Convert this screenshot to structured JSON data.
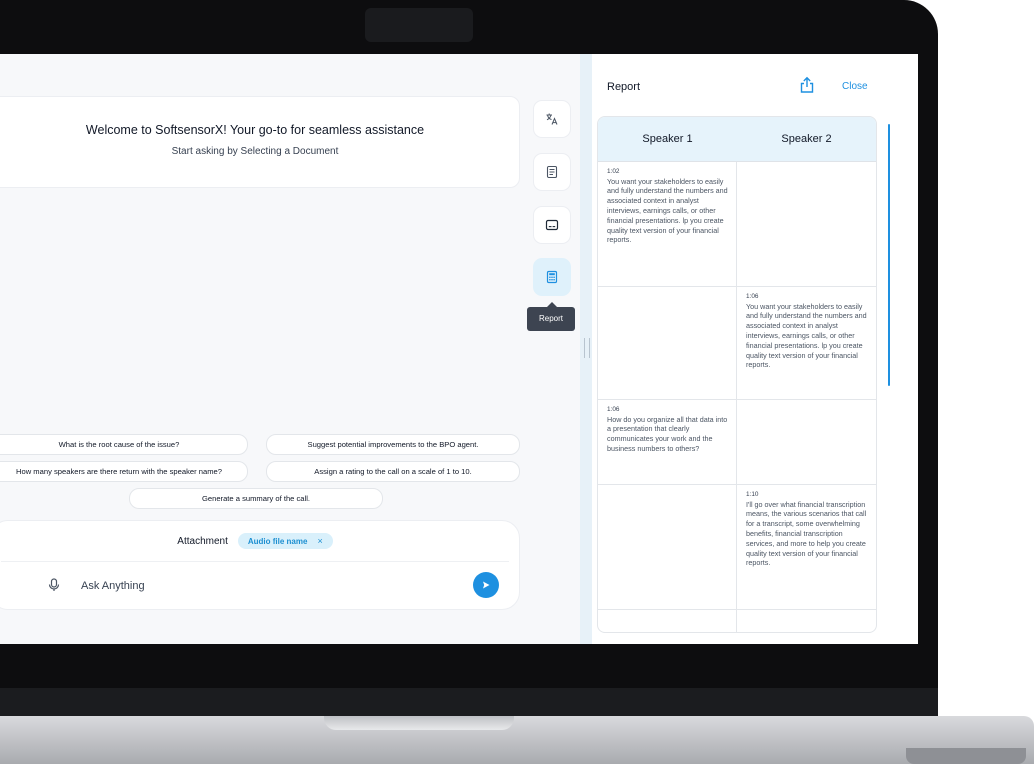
{
  "chat": {
    "welcome_title": "Welcome to SoftsensorX! Your go-to for seamless assistance",
    "welcome_subtitle": "Start asking by Selecting a Document",
    "suggestions": [
      "What is  the root cause of the issue?",
      "Suggest potential improvements to the BPO agent.",
      "How many speakers are there return with the speaker name?",
      "Assign a rating to the call on a scale of 1 to 10.",
      "Generate a summary of the call."
    ],
    "attachment_label": "Attachment",
    "attachment_file": "Audio file name",
    "attachment_remove": "×",
    "input_placeholder": "Ask Anything"
  },
  "rail": {
    "buttons": [
      "translate-icon",
      "document-icon",
      "subtitles-icon",
      "calculator-icon"
    ],
    "active": "calculator-icon",
    "tooltip": "Report"
  },
  "report": {
    "title": "Report",
    "close_label": "Close",
    "columns": [
      "Speaker 1",
      "Speaker 2"
    ],
    "rows": [
      {
        "speaker": 1,
        "time": "1:02",
        "text": "You want your stakeholders to easily and fully understand the numbers and associated context in analyst interviews, earnings calls, or other financial presentations. lp you create quality text version of your financial reports."
      },
      {
        "speaker": 2,
        "time": "1:06",
        "text": "You want your stakeholders to easily and fully understand the numbers and associated context in analyst interviews, earnings calls, or other financial presentations. lp you create quality text version of your financial reports."
      },
      {
        "speaker": 1,
        "time": "1:06",
        "text": "How do you organize all that data into a presentation that clearly communicates your work and the business numbers to others?"
      },
      {
        "speaker": 2,
        "time": "1:10",
        "text": "I'll go over what financial transcription means, the various scenarios that call for a transcript, some overwhelming benefits, financial transcription services, and more to help you create quality text version of your financial reports."
      }
    ]
  },
  "colors": {
    "accent": "#1e90e0",
    "header_bg": "#e6f3fb",
    "chip_bg": "#d9f0fb"
  }
}
